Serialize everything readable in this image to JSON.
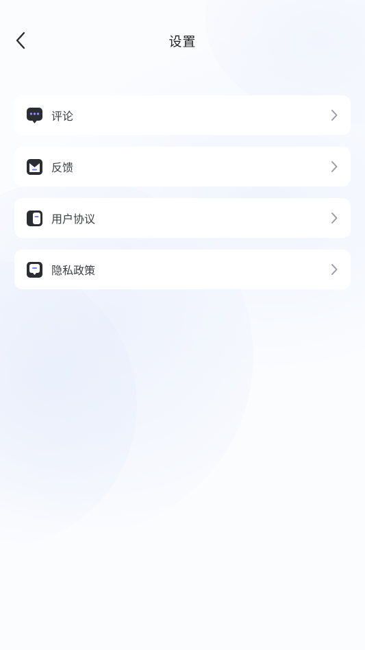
{
  "header": {
    "title": "设置",
    "back_icon": "chevron-left-icon"
  },
  "colors": {
    "icon_dark": "#2c2d33",
    "icon_accent": "#6f7fff",
    "chevron": "#9a9ca3",
    "text": "#3b3d42",
    "background": "#fbfcfe",
    "card": "#ffffff"
  },
  "settings": {
    "items": [
      {
        "label": "评论",
        "icon": "comment-icon"
      },
      {
        "label": "反馈",
        "icon": "feedback-icon"
      },
      {
        "label": "用户协议",
        "icon": "agreement-icon"
      },
      {
        "label": "隐私政策",
        "icon": "privacy-icon"
      }
    ]
  }
}
